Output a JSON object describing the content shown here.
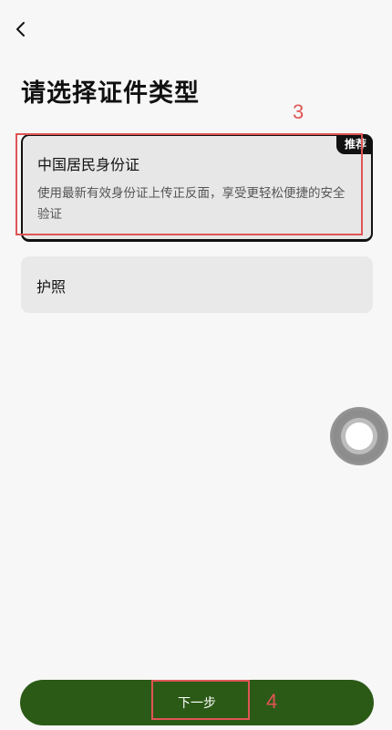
{
  "page": {
    "title": "请选择证件类型"
  },
  "options": [
    {
      "title": "中国居民身份证",
      "description": "使用最新有效身份证上传正反面，享受更轻松便捷的安全验证",
      "badge": "推荐",
      "selected": true
    },
    {
      "title": "护照",
      "selected": false
    }
  ],
  "footer": {
    "next_label": "下一步"
  },
  "annotations": {
    "option_marker": "3",
    "next_marker": "4",
    "color": "#e05555"
  },
  "colors": {
    "primary_button": "#2b5a16",
    "card_bg": "#e9e9e9",
    "page_bg": "#f7f7f7"
  },
  "icons": {
    "back": "chevron-left-icon",
    "floating_ball": "assistive-touch-icon"
  }
}
